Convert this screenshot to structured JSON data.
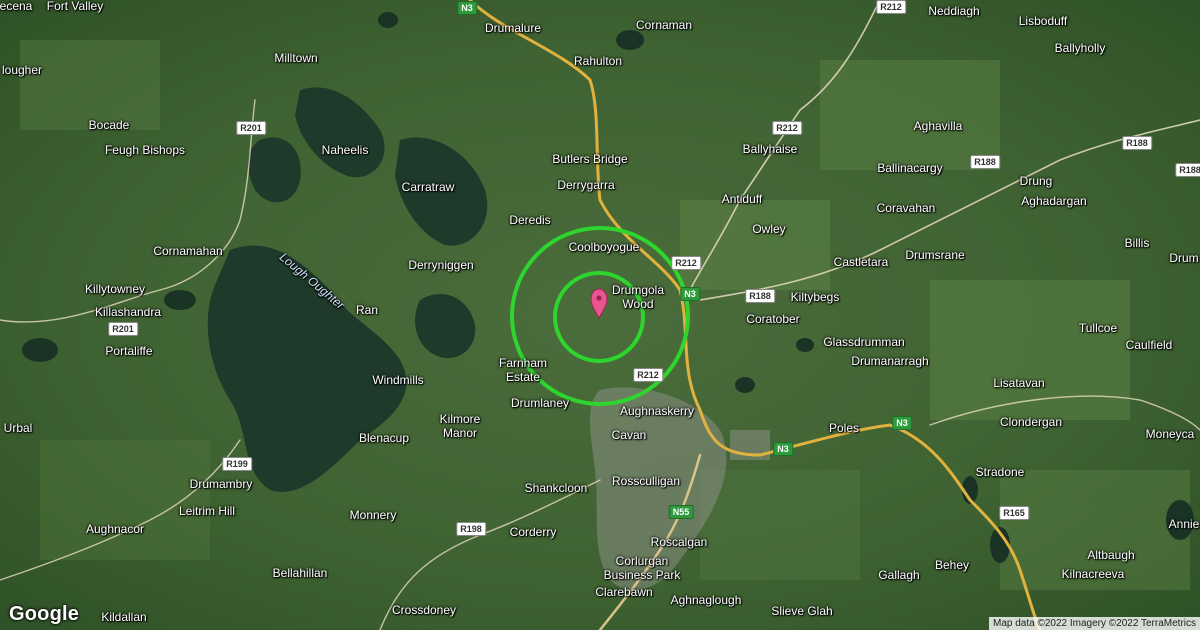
{
  "map": {
    "brand": "Google",
    "attribution": "Map data ©2022 Imagery ©2022 TerraMetrics",
    "marker_color": "#e8558f",
    "radius_ring_color": "#2ed52e",
    "background_imagery": "satellite"
  },
  "places": [
    {
      "name": "ecena",
      "size": "sm"
    },
    {
      "name": "Fort Valley",
      "size": "sm"
    },
    {
      "name": "Drumalure",
      "size": "sm"
    },
    {
      "name": "Cornaman",
      "size": "sm"
    },
    {
      "name": "Neddiagh",
      "size": "sm"
    },
    {
      "name": "Lisboduff",
      "size": "sm"
    },
    {
      "name": "Ballyholly",
      "size": "sm"
    },
    {
      "name": "Milltown",
      "size": "sm"
    },
    {
      "name": "Rahulton",
      "size": "sm"
    },
    {
      "name": "lougher",
      "size": "sm"
    },
    {
      "name": "Bocade",
      "size": "sm"
    },
    {
      "name": "Feugh Bishops",
      "size": "sm"
    },
    {
      "name": "Naheelis",
      "size": "sm"
    },
    {
      "name": "Butlers Bridge",
      "size": "sm"
    },
    {
      "name": "Ballyhaise",
      "size": "sm"
    },
    {
      "name": "Aghavilla",
      "size": "sm"
    },
    {
      "name": "Ballinacargy",
      "size": "sm"
    },
    {
      "name": "Carratraw",
      "size": "sm"
    },
    {
      "name": "Derrygarra",
      "size": "sm"
    },
    {
      "name": "Drung",
      "size": "sm"
    },
    {
      "name": "Aghadargan",
      "size": "sm"
    },
    {
      "name": "Antiduff",
      "size": "sm"
    },
    {
      "name": "Coravahan",
      "size": "sm"
    },
    {
      "name": "Deredis",
      "size": "sm"
    },
    {
      "name": "Owley",
      "size": "sm"
    },
    {
      "name": "Coolboyogue",
      "size": "sm"
    },
    {
      "name": "Billis",
      "size": "sm"
    },
    {
      "name": "Cornamahan",
      "size": "sm"
    },
    {
      "name": "Drumsrane",
      "size": "sm"
    },
    {
      "name": "Drum",
      "size": "sm"
    },
    {
      "name": "Castletara",
      "size": "sm"
    },
    {
      "name": "Derryniggen",
      "size": "sm"
    },
    {
      "name": "Drumgola\nWood",
      "size": "sm"
    },
    {
      "name": "Killytowney",
      "size": "sm"
    },
    {
      "name": "Kiltybegs",
      "size": "sm"
    },
    {
      "name": "Killashandra",
      "size": "sm"
    },
    {
      "name": "Ran",
      "size": "sm"
    },
    {
      "name": "Coratober",
      "size": "sm"
    },
    {
      "name": "Tullcoe",
      "size": "sm"
    },
    {
      "name": "Portaliffe",
      "size": "sm"
    },
    {
      "name": "Glassdrumman",
      "size": "sm"
    },
    {
      "name": "Caulfield",
      "size": "sm"
    },
    {
      "name": "Drumanarragh",
      "size": "sm"
    },
    {
      "name": "Farnham\nEstate",
      "size": "sm"
    },
    {
      "name": "Windmills",
      "size": "sm"
    },
    {
      "name": "Lisatavan",
      "size": "sm"
    },
    {
      "name": "Drumlaney",
      "size": "sm"
    },
    {
      "name": "Aughnaskerry",
      "size": "sm"
    },
    {
      "name": "Kilmore\nManor",
      "size": "sm"
    },
    {
      "name": "Clondergan",
      "size": "sm"
    },
    {
      "name": "Urbal",
      "size": "sm"
    },
    {
      "name": "Poles",
      "size": "sm"
    },
    {
      "name": "Moneyca",
      "size": "sm"
    },
    {
      "name": "Cavan",
      "size": "sm"
    },
    {
      "name": "Blenacup",
      "size": "sm"
    },
    {
      "name": "Stradone",
      "size": "sm"
    },
    {
      "name": "Drumambry",
      "size": "sm"
    },
    {
      "name": "Rossculligan",
      "size": "sm"
    },
    {
      "name": "Shankcloon",
      "size": "sm"
    },
    {
      "name": "Leitrim Hill",
      "size": "sm"
    },
    {
      "name": "Monnery",
      "size": "sm"
    },
    {
      "name": "Aughnacor",
      "size": "sm"
    },
    {
      "name": "Annie",
      "size": "sm"
    },
    {
      "name": "Corderry",
      "size": "sm"
    },
    {
      "name": "Roscalgan",
      "size": "sm"
    },
    {
      "name": "Altbaugh",
      "size": "sm"
    },
    {
      "name": "Corlurgan\nBusiness Park",
      "size": "sm"
    },
    {
      "name": "Behey",
      "size": "sm"
    },
    {
      "name": "Kilnacreeva",
      "size": "sm"
    },
    {
      "name": "Bellahillan",
      "size": "sm"
    },
    {
      "name": "Gallagh",
      "size": "sm"
    },
    {
      "name": "Clarebawn",
      "size": "sm"
    },
    {
      "name": "Crossdoney",
      "size": "sm"
    },
    {
      "name": "Aghnaglough",
      "size": "sm"
    },
    {
      "name": "Slieve Glah",
      "size": "sm"
    },
    {
      "name": "Kildallan",
      "size": "sm"
    }
  ],
  "water_labels": [
    {
      "name": "Lough Oughter"
    }
  ],
  "road_shields": [
    {
      "label": "N3",
      "type": "n"
    },
    {
      "label": "R212",
      "type": "r"
    },
    {
      "label": "R201",
      "type": "r"
    },
    {
      "label": "R212",
      "type": "r"
    },
    {
      "label": "R188",
      "type": "r"
    },
    {
      "label": "R188",
      "type": "r"
    },
    {
      "label": "R188",
      "type": "r"
    },
    {
      "label": "R212",
      "type": "r"
    },
    {
      "label": "N3",
      "type": "n"
    },
    {
      "label": "R188",
      "type": "r"
    },
    {
      "label": "R201",
      "type": "r"
    },
    {
      "label": "R212",
      "type": "r"
    },
    {
      "label": "N3",
      "type": "n"
    },
    {
      "label": "N3",
      "type": "n"
    },
    {
      "label": "R199",
      "type": "r"
    },
    {
      "label": "N55",
      "type": "n"
    },
    {
      "label": "R165",
      "type": "r"
    },
    {
      "label": "R198",
      "type": "r"
    }
  ]
}
